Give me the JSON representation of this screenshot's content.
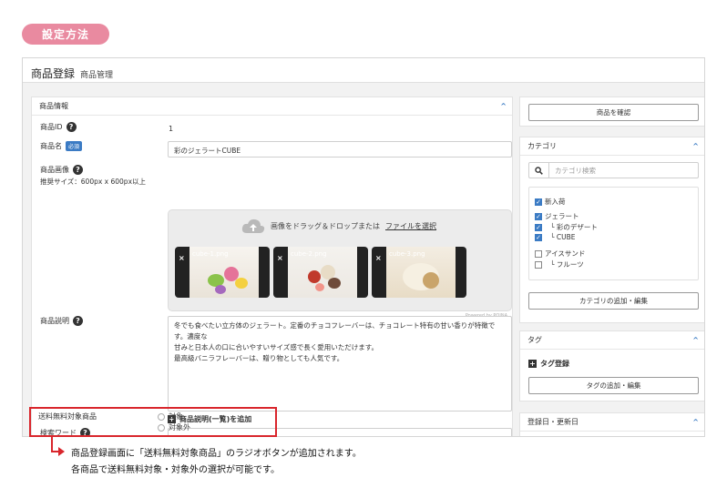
{
  "badge": "設定方法",
  "topbar": {
    "title": "商品登録",
    "subtitle": "商品管理"
  },
  "main": {
    "section_title": "商品情報",
    "product_id_label": "商品ID",
    "product_id_value": "1",
    "product_name_label": "商品名",
    "required_badge": "必須",
    "product_name_value": "彩のジェラートCUBE",
    "image_label": "商品画像",
    "image_size_note": "推奨サイズ：600px x 600px以上",
    "drop_text": "画像をドラッグ＆ドロップまたは",
    "drop_link": "ファイルを選択",
    "images": [
      "cube-1.png",
      "cube-2.png",
      "cube-3.png"
    ],
    "powered": "Powered by PQINA",
    "description_label": "商品説明",
    "description_lines": [
      "冬でも食べたい立方体のジェラート。定番のチョコフレーバーは、チョコレート特有の甘い香りが特徴です。濃度な",
      "甘みと日本人の口に合いやすいサイズ感で長く愛用いただけます。",
      "最高級バニラフレーバーは、贈り物としても人気です。"
    ],
    "add_list_desc": "商品説明(一覧)を追加",
    "search_word_label": "検索ワード",
    "free_shipping_label": "送料無料対象商品",
    "radio_options": [
      "対象",
      "対象外"
    ]
  },
  "sidebar": {
    "confirm_button": "商品を確認",
    "category_title": "カテゴリ",
    "category_search_placeholder": "カテゴリ検索",
    "categories": [
      {
        "label": "新入荷",
        "checked": true
      },
      {
        "label": "ジェラート",
        "checked": true
      },
      {
        "label": "└ 彩のデザート",
        "checked": true
      },
      {
        "label": "└ CUBE",
        "checked": true
      },
      {
        "label": "アイスサンド",
        "checked": false
      },
      {
        "label": "└ フルーツ",
        "checked": false
      }
    ],
    "category_edit_button": "カテゴリの追加・編集",
    "tag_title": "タグ",
    "tag_register": "タグ登録",
    "tag_edit_button": "タグの追加・編集",
    "dates_title": "登録日・更新日"
  },
  "note": {
    "line1": "商品登録画面に「送料無料対象商品」のラジオボタンが追加されます。",
    "line2": "各商品で送料無料対象・対象外の選択が可能です。"
  },
  "colors": {
    "accent": "#3b7bc4",
    "badge": "#e98aa0",
    "highlight": "#d9262c"
  }
}
